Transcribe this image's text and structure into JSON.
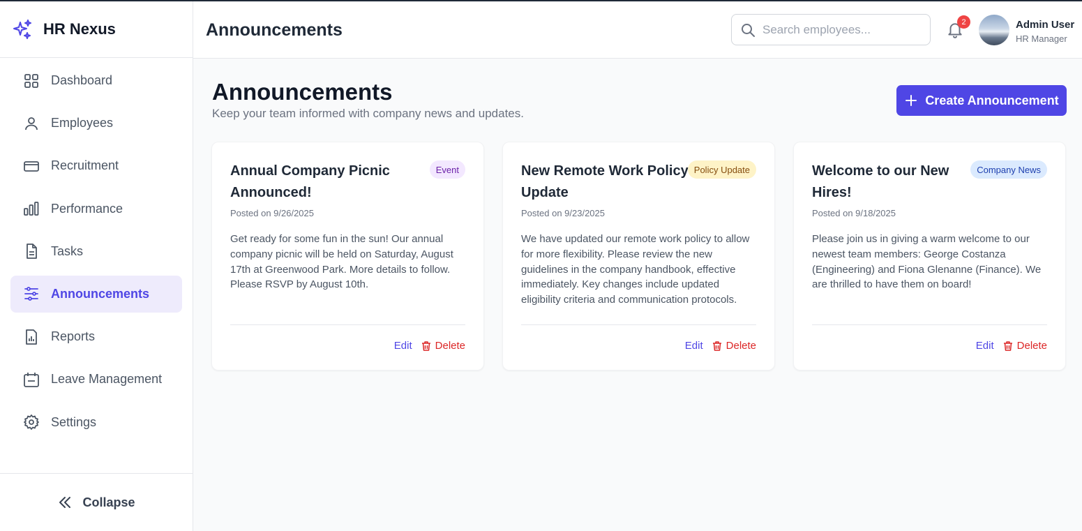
{
  "app": {
    "name": "HR Nexus"
  },
  "sidebar": {
    "items": [
      {
        "label": "Dashboard",
        "icon": "grid-icon"
      },
      {
        "label": "Employees",
        "icon": "user-icon"
      },
      {
        "label": "Recruitment",
        "icon": "card-icon"
      },
      {
        "label": "Performance",
        "icon": "bar-chart-icon"
      },
      {
        "label": "Tasks",
        "icon": "document-icon"
      },
      {
        "label": "Announcements",
        "icon": "sliders-icon",
        "active": true
      },
      {
        "label": "Reports",
        "icon": "report-icon"
      },
      {
        "label": "Leave Management",
        "icon": "calendar-icon"
      },
      {
        "label": "Settings",
        "icon": "gear-icon"
      }
    ],
    "collapse_label": "Collapse"
  },
  "header": {
    "title": "Announcements",
    "search_placeholder": "Search employees...",
    "notification_count": "2",
    "user_name": "Admin User",
    "user_role": "HR Manager"
  },
  "page": {
    "title": "Announcements",
    "subtitle": "Keep your team informed with company news and updates.",
    "create_button": "Create Announcement"
  },
  "announcements": [
    {
      "title": "Annual Company Picnic Announced!",
      "badge": "Event",
      "date": "Posted on 9/26/2025",
      "body": "Get ready for some fun in the sun! Our annual company picnic will be held on Saturday, August 17th at Greenwood Park. More details to follow. Please RSVP by August 10th.",
      "edit": "Edit",
      "delete": "Delete"
    },
    {
      "title": "New Remote Work Policy Update",
      "badge": "Policy Update",
      "date": "Posted on 9/23/2025",
      "body": "We have updated our remote work policy to allow for more flexibility. Please review the new guidelines in the company handbook, effective immediately. Key changes include updated eligibility criteria and communication protocols.",
      "edit": "Edit",
      "delete": "Delete"
    },
    {
      "title": "Welcome to our New Hires!",
      "badge": "Company News",
      "date": "Posted on 9/18/2025",
      "body": "Please join us in giving a warm welcome to our newest team members: George Costanza (Engineering) and Fiona Glenanne (Finance). We are thrilled to have them on board!",
      "edit": "Edit",
      "delete": "Delete"
    }
  ],
  "colors": {
    "accent": "#4f46e5",
    "danger": "#dc2626",
    "badge_event_bg": "#f3e8ff",
    "badge_event_text": "#6b21a8",
    "badge_policy_bg": "#fef3c7",
    "badge_policy_text": "#854d0e",
    "badge_news_bg": "#dbeafe",
    "badge_news_text": "#1e40af"
  }
}
